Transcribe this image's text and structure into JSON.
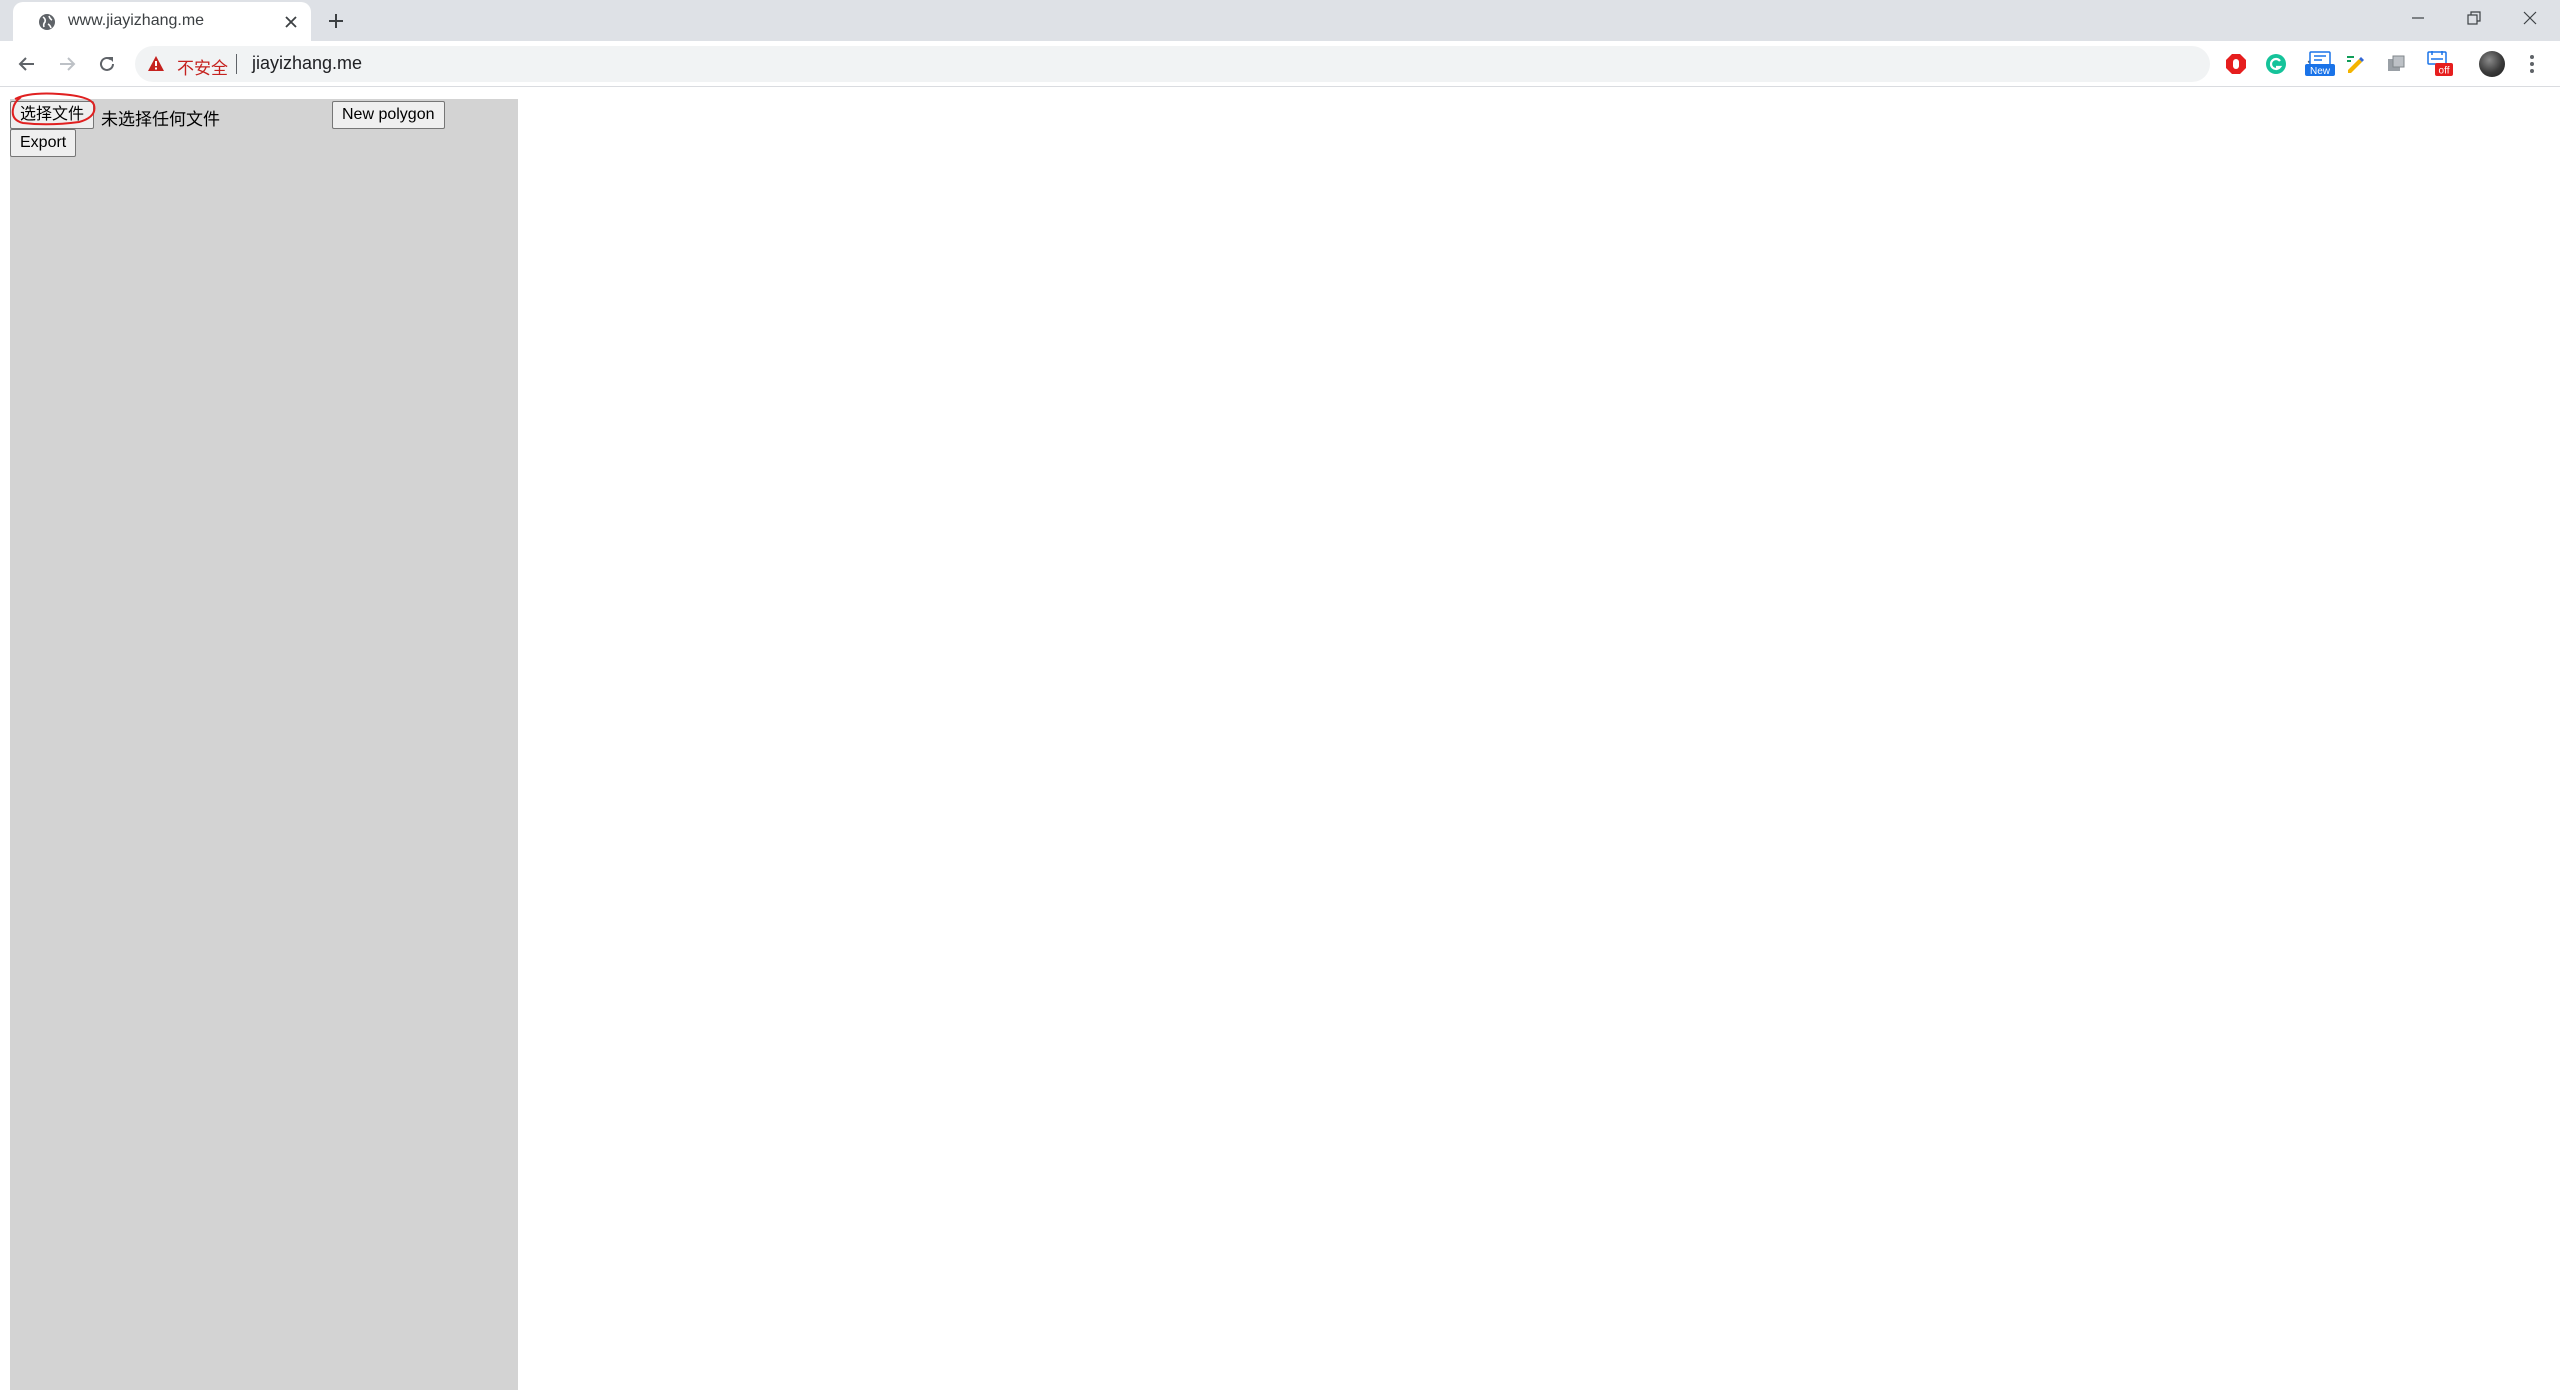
{
  "browser": {
    "tab": {
      "title": "www.jiayizhang.me",
      "favicon": "globe-icon"
    },
    "new_tab_icon": "plus-icon",
    "window_controls": [
      "minimize-icon",
      "restore-icon",
      "close-icon"
    ],
    "nav": [
      "back-arrow-icon",
      "forward-arrow-icon",
      "reload-icon"
    ],
    "address": {
      "security_label": "不安全",
      "url": "jiayizhang.me",
      "security_color": "#c5221f"
    },
    "extensions": {
      "new_badge": "New",
      "off_badge": "off"
    }
  },
  "page": {
    "file_input": {
      "button_label": "选择文件",
      "status": "未选择任何文件"
    },
    "new_polygon_label": "New polygon",
    "export_label": "Export",
    "panel_color": "#d3d3d3"
  }
}
